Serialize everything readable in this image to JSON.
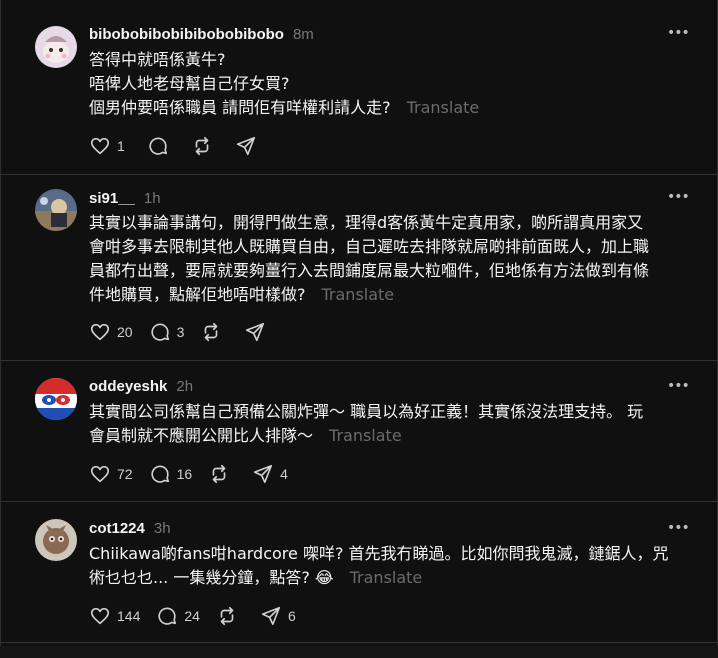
{
  "posts": [
    {
      "username": "bibobobibobibibobobibobo",
      "time": "8m",
      "lines": [
        "答得中就唔係黃牛?",
        "唔俾人地老母幫自己仔女買?",
        "個男仲要唔係職員 請問佢有咩權利請人走?"
      ],
      "translate": "Translate",
      "likes": "1",
      "comments": "",
      "reposts": "",
      "shares": ""
    },
    {
      "username": "si91__",
      "time": "1h",
      "lines": [
        "其實以事論事講句，開得門做生意，理得d客係黃牛定真用家，啲所謂真用家又",
        "會咁多事去限制其他人既購買自由，自己遲咗去排隊就屌啲排前面既人，加上職",
        "員都冇出聲，要屌就要夠薑行入去間鋪度屌最大粒嗰件，佢地係有方法做到有條",
        "件地購買，點解佢地唔咁樣做?"
      ],
      "translate": "Translate",
      "likes": "20",
      "comments": "3",
      "reposts": "",
      "shares": ""
    },
    {
      "username": "oddeyeshk",
      "time": "2h",
      "lines": [
        "其實間公司係幫自己預備公關炸彈～ 職員以為好正義！其實係沒法理支持。 玩",
        "會員制就不應開公開比人排隊～"
      ],
      "translate": "Translate",
      "likes": "72",
      "comments": "16",
      "reposts": "",
      "shares": "4"
    },
    {
      "username": "cot1224",
      "time": "3h",
      "lines": [
        "Chiikawa啲fans咁hardcore 㗎咩? 首先我冇睇過。比如你問我鬼滅，鏈鋸人，咒",
        "術乜乜乜... 一集幾分鐘，點答? 😂"
      ],
      "translate": "Translate",
      "likes": "144",
      "comments": "24",
      "reposts": "",
      "shares": "6"
    }
  ],
  "icons": {
    "like": "heart-icon",
    "comment": "comment-icon",
    "repost": "repost-icon",
    "share": "share-icon",
    "more": "more-icon"
  },
  "colors": {
    "background": "#101010",
    "text": "#f3f5f7",
    "muted": "#777777",
    "divider": "#323232"
  }
}
